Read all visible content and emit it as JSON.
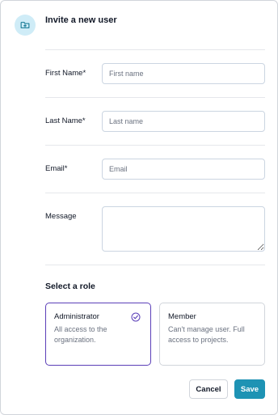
{
  "dialog": {
    "title": "Invite a new user",
    "icon": "folder-plus-icon",
    "accent_color": "#cfecf7"
  },
  "fields": [
    {
      "label": "First Name*",
      "placeholder": "First name",
      "value": ""
    },
    {
      "label": "Last Name*",
      "placeholder": "Last name",
      "value": ""
    },
    {
      "label": "Email*",
      "placeholder": "Email",
      "value": ""
    },
    {
      "label": "Message",
      "placeholder": "",
      "value": ""
    }
  ],
  "roles": {
    "title": "Select a role",
    "options": [
      {
        "name": "Administrator",
        "description": "All access to the organization.",
        "selected": true
      },
      {
        "name": "Member",
        "description": "Can't manage user. Full access to projects.",
        "selected": false
      }
    ],
    "selected_color": "#5b3fb8"
  },
  "actions": {
    "cancel_label": "Cancel",
    "save_label": "Save",
    "save_color": "#1e93b4"
  }
}
